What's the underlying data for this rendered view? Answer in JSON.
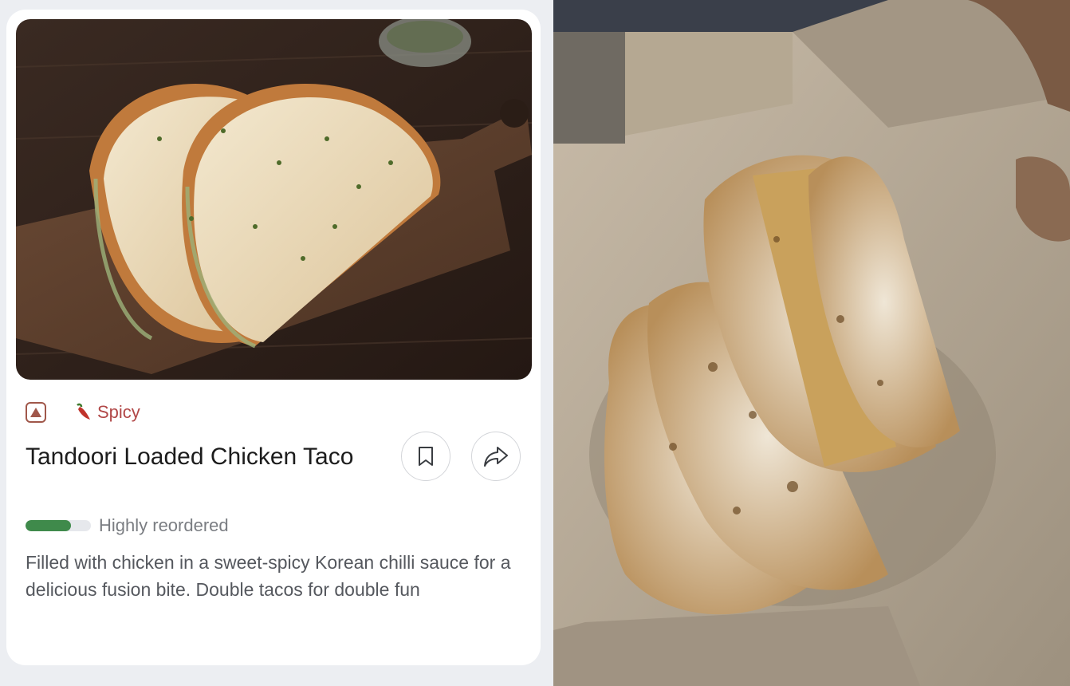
{
  "tags": {
    "veg_indicator_icon": "nonveg-triangle-icon",
    "spicy_icon": "chilli-icon",
    "spicy_label": "Spicy"
  },
  "item": {
    "title": "Tandoori Loaded Chicken Taco",
    "reorder_label": "Highly reordered",
    "reorder_level": 0.7,
    "description": "Filled with chicken in a sweet-spicy Korean chilli sauce for a delicious fusion bite. Double tacos for double fun"
  },
  "actions": {
    "bookmark_icon": "bookmark-icon",
    "share_icon": "share-icon"
  },
  "colors": {
    "spicy": "#b14747",
    "reorder_fill": "#3f8a4b",
    "nonveg_border": "#a0574a"
  }
}
